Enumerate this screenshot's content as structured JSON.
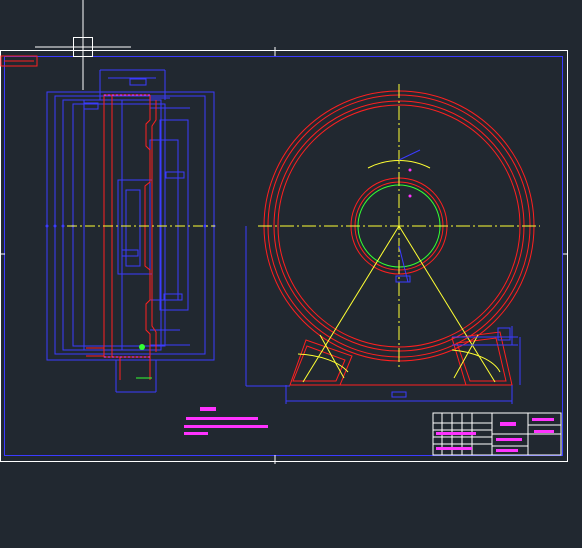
{
  "colors": {
    "background": "#212830",
    "border": "#ffffff",
    "frame": "#3b3bff",
    "part": "#ff2020",
    "centerline": "#ffff33",
    "annotation": "#ff33ff",
    "highlight": "#33ff33",
    "cursor": "#ffffff"
  },
  "drawing": {
    "stamp_text": "",
    "notes_title": "",
    "notes_lines": [
      "",
      ""
    ],
    "title_block_labels": [
      "",
      "",
      ""
    ]
  },
  "cursor": {
    "icon": "crosshair-cursor-icon"
  }
}
